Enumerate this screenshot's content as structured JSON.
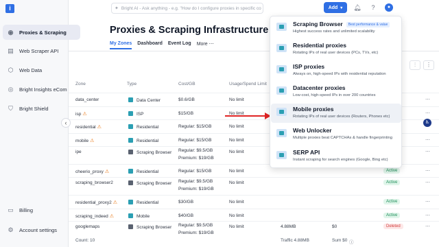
{
  "app": {
    "logo_text": "i"
  },
  "sidebar": {
    "items": [
      {
        "label": "Proxies & Scraping",
        "icon": "location-pin-icon"
      },
      {
        "label": "Web Scraper API",
        "icon": "api-icon"
      },
      {
        "label": "Web Data",
        "icon": "hexagon-icon"
      },
      {
        "label": "Bright Insights eCom",
        "icon": "insights-icon"
      },
      {
        "label": "Bright Shield",
        "icon": "shield-icon"
      }
    ],
    "bottom": [
      {
        "label": "Billing",
        "icon": "billing-icon"
      },
      {
        "label": "Account settings",
        "icon": "gear-icon"
      }
    ]
  },
  "topbar": {
    "search_placeholder": "Bright AI - Ask anything - e.g. \"How do I configure proxies in specific co",
    "add_label": "Add"
  },
  "page": {
    "title": "Proxies & Scraping Infrastructure",
    "tabs": [
      "My Zones",
      "Dashboard",
      "Event Log",
      "More"
    ]
  },
  "table": {
    "headers": [
      "Zone",
      "Type",
      "Cost/GB",
      "Usage/Spend Limit"
    ],
    "rows": [
      {
        "zone": "data_center",
        "warn": false,
        "type": "Data Center",
        "cost": "$0.6/GB",
        "cost2": "",
        "limit": "No limit"
      },
      {
        "zone": "isp",
        "warn": true,
        "type": "ISP",
        "cost": "$15/GB",
        "cost2": "",
        "limit": "No limit"
      },
      {
        "zone": "residential",
        "warn": true,
        "type": "Residential",
        "cost": "Regular: $15/GB",
        "cost2": "",
        "limit": "No limit"
      },
      {
        "zone": "mobile",
        "warn": true,
        "type": "Residential",
        "cost": "Regular: $15/GB",
        "cost2": "",
        "limit": "No limit"
      },
      {
        "zone": "ipe",
        "warn": false,
        "type": "Scraping Browser",
        "cost": "Regular: $9.5/GB",
        "cost2": "Premium: $19/GB",
        "limit": "No limit"
      },
      {
        "zone": "cheerio_proxy",
        "warn": true,
        "type": "Residential",
        "cost": "Regular: $15/GB",
        "cost2": "",
        "limit": "No limit",
        "status": "Active"
      },
      {
        "zone": "scraping_browser2",
        "warn": false,
        "type": "Scraping Browser",
        "cost": "Regular: $9.5/GB",
        "cost2": "Premium: $19/GB",
        "limit": "No limit",
        "status": "Active"
      },
      {
        "zone": "residential_proxy2",
        "warn": true,
        "type": "Residential",
        "cost": "$30/GB",
        "cost2": "",
        "limit": "No limit",
        "status": "Active"
      },
      {
        "zone": "scraping_indeed",
        "warn": true,
        "type": "Mobile",
        "cost": "$40/GB",
        "cost2": "",
        "limit": "No limit",
        "status": "Active"
      },
      {
        "zone": "googlemaps",
        "warn": false,
        "type": "Scraping Browser",
        "cost": "Regular: $9.5/GB",
        "cost2": "Premium: $19/GB",
        "limit": "No limit",
        "traffic": "4.88MB",
        "spend": "$0",
        "status": "Deleted"
      }
    ],
    "footer": {
      "count": "Count: 10",
      "traffic": "Traffic 4.88MB",
      "sum": "Sum $0"
    }
  },
  "dropdown": {
    "products": [
      {
        "title": "Scraping Browser",
        "badge": "Best performance & value",
        "desc": "Highest success rates and unlimited scalability"
      },
      {
        "title": "Residential proxies",
        "badge": "",
        "desc": "Rotating IPs of real user devices (PCs, TVs, etc)"
      },
      {
        "title": "ISP proxies",
        "badge": "",
        "desc": "Always on, high-speed IPs with residential reputation"
      },
      {
        "title": "Datacenter proxies",
        "badge": "",
        "desc": "Low-cost, high-speed IPs in over 200 countries"
      },
      {
        "title": "Mobile proxies",
        "badge": "",
        "desc": "Rotating IPs of real user devices (Routers, Phones etc)"
      },
      {
        "title": "Web Unlocker",
        "badge": "",
        "desc": "Multiple proxies beat CAPTCHAs & handle fingerprinting"
      },
      {
        "title": "SERP API",
        "badge": "",
        "desc": "Instant scraping for search engines (Google, Bing etc)"
      }
    ]
  },
  "colors": {
    "accent": "#2f6fe4",
    "arrow": "#e02424",
    "active": "#1e8e5a",
    "deleted": "#d23f3f"
  }
}
